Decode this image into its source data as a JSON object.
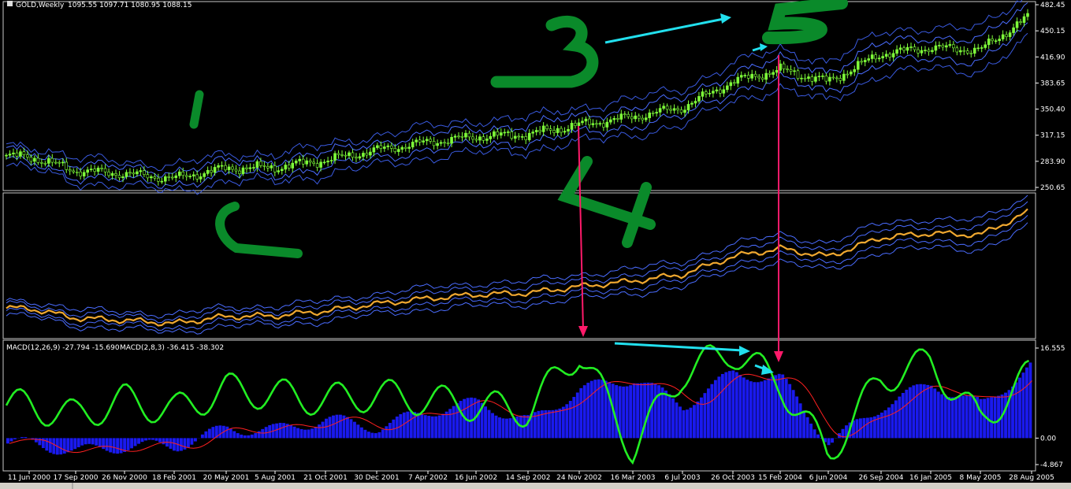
{
  "window": {
    "symbol_title": "GOLD,Weekly",
    "ohlc": "1095.55 1097.71 1080.95 1088.15",
    "macd_label": "MACD(12,26,9) -27.794 -15.690",
    "macd2_label": "MACD(2,8,3) -36.415 -38.302"
  },
  "annotations": [
    "1",
    "2",
    "3",
    "4",
    "5"
  ],
  "colors": {
    "background": "#000000",
    "candle": "#7fff3a",
    "bands": "#4a6cff",
    "price_line": "#f0a830",
    "macd_line": "#22ee22",
    "macd_signal": "#ff2020",
    "histogram": "#1a1aee",
    "hand_green": "#0a8a2a",
    "arrow_cyan": "#22e0ee",
    "arrow_pink": "#ff1a6a"
  },
  "chart_data": [
    {
      "type": "candlestick",
      "title": "GOLD,Weekly",
      "ylim": [
        250.65,
        482.45
      ],
      "yticks": [
        "482.45",
        "450.15",
        "416.90",
        "383.65",
        "350.40",
        "317.15",
        "283.90",
        "250.65"
      ],
      "grid": false,
      "series": [
        {
          "name": "GOLD",
          "x": [
            "11 Jun 2000",
            "17 Sep 2000",
            "26 Nov 2000",
            "18 Feb 2001",
            "20 May 2001",
            "5 Aug 2001",
            "21 Oct 2001",
            "30 Dec 2001",
            "7 Apr 2002",
            "16 Jun 2002",
            "14 Sep 2002",
            "24 Nov 2002",
            "16 Mar 2003",
            "6 Jul 2003",
            "26 Oct 2003",
            "15 Feb 2004",
            "6 Jun 2004",
            "26 Sep 2004",
            "16 Jan 2005",
            "8 May 2005",
            "28 Aug 2005"
          ],
          "values": [
            290,
            272,
            268,
            262,
            275,
            276,
            285,
            298,
            308,
            315,
            318,
            330,
            340,
            352,
            385,
            400,
            385,
            420,
            428,
            425,
            470
          ]
        }
      ]
    },
    {
      "type": "line",
      "series": [
        {
          "name": "",
          "values": [
            290,
            272,
            268,
            262,
            275,
            276,
            285,
            298,
            308,
            315,
            318,
            330,
            340,
            352,
            385,
            400,
            385,
            420,
            428,
            425,
            470
          ]
        }
      ]
    },
    {
      "type": "bar",
      "title": "MACD(12,26,9) -27.794 -15.690",
      "ylim": [
        -4.867,
        16.555
      ],
      "yticks": [
        "16.555",
        "0.00",
        "-4.867"
      ],
      "xticks": [
        "11 Jun 2000",
        "17 Sep 2000",
        "26 Nov 2000",
        "18 Feb 2001",
        "20 May 2001",
        "5 Aug 2001",
        "21 Oct 2001",
        "30 Dec 2001",
        "7 Apr 2002",
        "16 Jun 2002",
        "14 Sep 2002",
        "24 Nov 2002",
        "16 Mar 2003",
        "6 Jul 2003",
        "26 Oct 2003",
        "15 Feb 2004",
        "6 Jun 2004",
        "26 Sep 2004",
        "16 Jan 2005",
        "8 May 2005",
        "28 Aug 2005"
      ],
      "series": [
        {
          "name": "MACD(12,26,9)",
          "values": [
            -1,
            -2.5,
            -1.5,
            -1.5,
            1.8,
            1.5,
            3.5,
            2,
            5,
            6.5,
            3,
            9,
            11,
            6,
            12,
            10.8,
            -1,
            6,
            10,
            6,
            13.6
          ]
        },
        {
          "name": "MACD(2,8,3)",
          "values": [
            6,
            4,
            7,
            5,
            9,
            8,
            7,
            8,
            7,
            6,
            5,
            16,
            -2,
            12,
            16,
            10,
            -3,
            11,
            14,
            3,
            12
          ]
        }
      ]
    }
  ]
}
